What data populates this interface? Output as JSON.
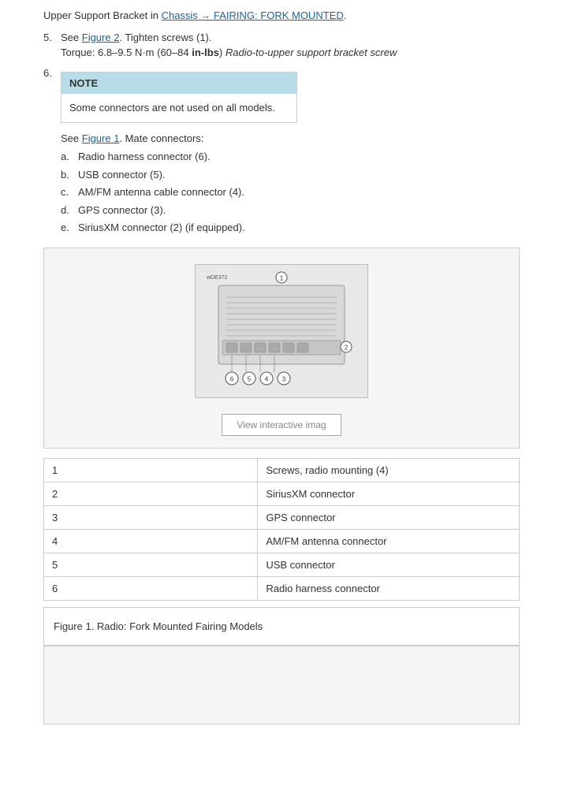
{
  "intro": {
    "line1": "Upper Support Bracket in ",
    "link_text": "Chassis → FAIRING: FORK MOUNTED",
    "link_href": "#"
  },
  "steps": [
    {
      "number": "5.",
      "content_parts": [
        {
          "type": "text",
          "text": "See "
        },
        {
          "type": "link",
          "text": "Figure 2",
          "href": "#"
        },
        {
          "type": "text",
          "text": ". Tighten screws (1)."
        }
      ],
      "sub_line": "Torque: 6.8–9.5 N·m (60–84 ",
      "sub_bold": "in-lbs",
      "sub_italic": " Radio-to-upper support bracket screw"
    },
    {
      "number": "6.",
      "note": {
        "header": "NOTE",
        "body": "Some connectors are not used on all models."
      },
      "see_line_pre": "See ",
      "see_link": "Figure 1",
      "see_line_post": ". Mate connectors:",
      "sub_items": [
        {
          "label": "a.",
          "text": "Radio harness connector (6)."
        },
        {
          "label": "b.",
          "text": "USB connector (5)."
        },
        {
          "label": "c.",
          "text": "AM/FM antenna cable connector (4)."
        },
        {
          "label": "d.",
          "text": "GPS connector (3)."
        },
        {
          "label": "e.",
          "text": "SiriusXM connector (2) (if equipped)."
        }
      ]
    }
  ],
  "table": {
    "rows": [
      {
        "number": "1",
        "description": "Screws, radio mounting (4)"
      },
      {
        "number": "2",
        "description": "SiriusXM connector"
      },
      {
        "number": "3",
        "description": "GPS connector"
      },
      {
        "number": "4",
        "description": "AM/FM antenna connector"
      },
      {
        "number": "5",
        "description": "USB connector"
      },
      {
        "number": "6",
        "description": "Radio harness connector"
      }
    ]
  },
  "figure": {
    "caption": "Figure 1. Radio: Fork Mounted Fairing Models",
    "image_code": "w\u0000DE372",
    "view_btn_label": "View interactive imag"
  },
  "callout_numbers": [
    "1",
    "2",
    "3",
    "4",
    "5",
    "6"
  ]
}
